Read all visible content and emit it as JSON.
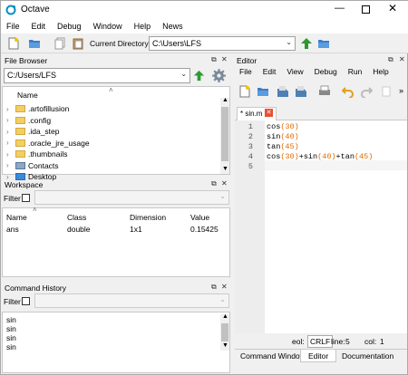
{
  "window": {
    "title": "Octave"
  },
  "menu": [
    "File",
    "Edit",
    "Debug",
    "Window",
    "Help",
    "News"
  ],
  "toolbar": {
    "current_dir_label": "Current Directory:",
    "current_dir_value": "C:\\Users\\LFS"
  },
  "file_browser": {
    "title": "File Browser",
    "path": "C:/Users/LFS",
    "column_name": "Name",
    "items": [
      {
        "name": ".artofillusion",
        "type": "folder"
      },
      {
        "name": ".config",
        "type": "folder"
      },
      {
        "name": ".ida_step",
        "type": "folder"
      },
      {
        "name": ".oracle_jre_usage",
        "type": "folder"
      },
      {
        "name": ".thumbnails",
        "type": "folder"
      },
      {
        "name": "Contacts",
        "type": "contacts"
      },
      {
        "name": "Desktop",
        "type": "desktop"
      }
    ]
  },
  "workspace": {
    "title": "Workspace",
    "filter_label": "Filter",
    "columns": [
      "Name",
      "Class",
      "Dimension",
      "Value"
    ],
    "rows": [
      {
        "name": "ans",
        "class": "double",
        "dimension": "1x1",
        "value": "0.15425"
      }
    ]
  },
  "history": {
    "title": "Command History",
    "filter_label": "Filter",
    "items": [
      "sin",
      "sin",
      "sin",
      "sin"
    ]
  },
  "editor": {
    "title": "Editor",
    "menu": [
      "File",
      "Edit",
      "View",
      "Debug",
      "Run",
      "Help"
    ],
    "tab_label": "* sin.m",
    "lines": [
      {
        "n": "1",
        "parts": [
          {
            "t": "cos",
            "c": "kw"
          },
          {
            "t": "(30)",
            "c": "num"
          }
        ]
      },
      {
        "n": "2",
        "parts": [
          {
            "t": "sin",
            "c": "kw"
          },
          {
            "t": "(40)",
            "c": "num"
          }
        ]
      },
      {
        "n": "3",
        "parts": [
          {
            "t": "tan",
            "c": "kw"
          },
          {
            "t": "(45)",
            "c": "num"
          }
        ]
      },
      {
        "n": "4",
        "parts": [
          {
            "t": "cos",
            "c": "kw"
          },
          {
            "t": "(30)",
            "c": "num"
          },
          {
            "t": "+sin",
            "c": "kw"
          },
          {
            "t": "(40)",
            "c": "num"
          },
          {
            "t": "+tan",
            "c": "kw"
          },
          {
            "t": "(45)",
            "c": "num"
          }
        ]
      },
      {
        "n": "5",
        "parts": []
      }
    ],
    "status": {
      "eol_label": "eol:",
      "eol": "CRLF",
      "line_label": "line:",
      "line": "5",
      "col_label": "col:",
      "col": "1"
    }
  },
  "bottom_tabs": [
    "Command Window",
    "Editor",
    "Documentation"
  ]
}
